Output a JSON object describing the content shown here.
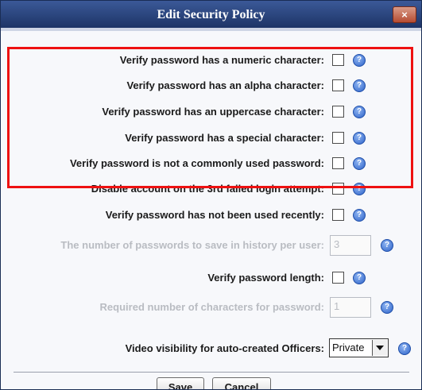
{
  "dialog": {
    "title": "Edit Security Policy",
    "close_label": "×"
  },
  "options": [
    {
      "label": "Verify password has a numeric character:",
      "checked": false
    },
    {
      "label": "Verify password has an alpha character:",
      "checked": false
    },
    {
      "label": "Verify password has an uppercase character:",
      "checked": false
    },
    {
      "label": "Verify password has a special character:",
      "checked": false
    },
    {
      "label": "Verify password is not a commonly used password:",
      "checked": false
    },
    {
      "label": "Disable account on the 3rd failed login attempt:",
      "checked": false
    },
    {
      "label": "Verify password has not been used recently:",
      "checked": false
    }
  ],
  "history": {
    "label": "The number of passwords to save in history per user:",
    "value": "3",
    "enabled": false
  },
  "length_check": {
    "label": "Verify password length:",
    "checked": false
  },
  "length_required": {
    "label": "Required number of characters for password:",
    "value": "1",
    "enabled": false
  },
  "video_visibility": {
    "label": "Video visibility for auto-created Officers:",
    "selected": "Private"
  },
  "help_icon": "?",
  "buttons": {
    "save": "Save",
    "cancel": "Cancel"
  },
  "colors": {
    "highlight": "#ee1111",
    "titlebar": "#2a4580",
    "help_icon": "#2e63c9"
  }
}
